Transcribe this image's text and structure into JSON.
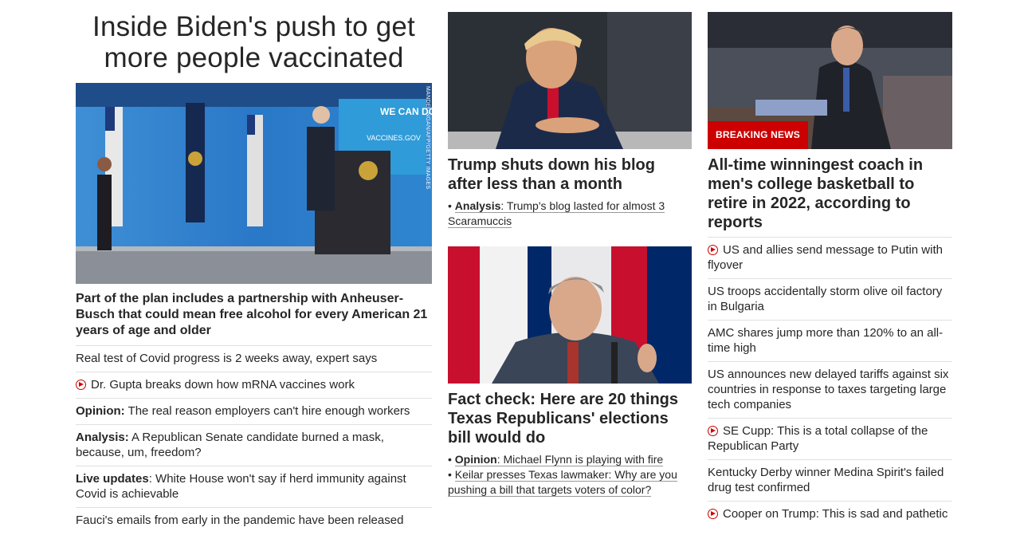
{
  "col1": {
    "headline": "Inside Biden's push to get more people vaccinated",
    "photo_credit": "MANDEL NGAN/AFP/GETTY IMAGES",
    "photo_banner": "WE CAN DO THIS",
    "photo_banner_url": "VACCINES.GOV",
    "subhead": "Part of the plan includes a partnership with Anheuser-Busch that could mean free alcohol for every American 21 years of age and older",
    "items": [
      {
        "prefix": "",
        "text": "Real test of Covid progress is 2 weeks away, expert says",
        "video": false
      },
      {
        "prefix": "",
        "text": "Dr. Gupta breaks down how mRNA vaccines work",
        "video": true
      },
      {
        "prefix": "Opinion:",
        "text": " The real reason employers can't hire enough workers",
        "video": false
      },
      {
        "prefix": "Analysis:",
        "text": " A Republican Senate candidate burned a mask, because, um, freedom?",
        "video": false
      },
      {
        "prefix": "Live updates",
        "text": ": White House won't say if herd immunity against Covid is achievable",
        "video": false
      },
      {
        "prefix": "",
        "text": "Fauci's emails from early in the pandemic have been released",
        "video": false
      }
    ]
  },
  "col2": {
    "story1": {
      "headline": "Trump shuts down his blog after less than a month",
      "bullet_label": "Analysis",
      "bullet_text": ": Trump's blog lasted for almost 3 Scaramuccis"
    },
    "story2": {
      "headline": "Fact check: Here are 20 things Texas Republicans' elections bill would do",
      "bullets": [
        {
          "label": "Opinion",
          "text": ": Michael Flynn is playing with fire"
        },
        {
          "label": "",
          "text": "Keilar presses Texas lawmaker: Why are you pushing a bill that targets voters of color?"
        }
      ]
    }
  },
  "col3": {
    "badge": "BREAKING NEWS",
    "headline": "All-time winningest coach in men's college basketball to retire in 2022, according to reports",
    "items": [
      {
        "text": "US and allies send message to Putin with flyover",
        "video": true
      },
      {
        "text": "US troops accidentally storm olive oil factory in Bulgaria",
        "video": false
      },
      {
        "text": "AMC shares jump more than 120% to an all-time high",
        "video": false
      },
      {
        "text": "US announces new delayed tariffs against six countries in response to taxes targeting large tech companies",
        "video": false
      },
      {
        "text": "SE Cupp: This is a total collapse of the Republican Party",
        "video": true
      },
      {
        "text": "Kentucky Derby winner Medina Spirit's failed drug test confirmed",
        "video": false
      },
      {
        "text": "Cooper on Trump: This is sad and pathetic",
        "video": true
      }
    ]
  },
  "colors": {
    "accent": "#cc0000",
    "text": "#262626",
    "divider": "#e0e0e0"
  }
}
